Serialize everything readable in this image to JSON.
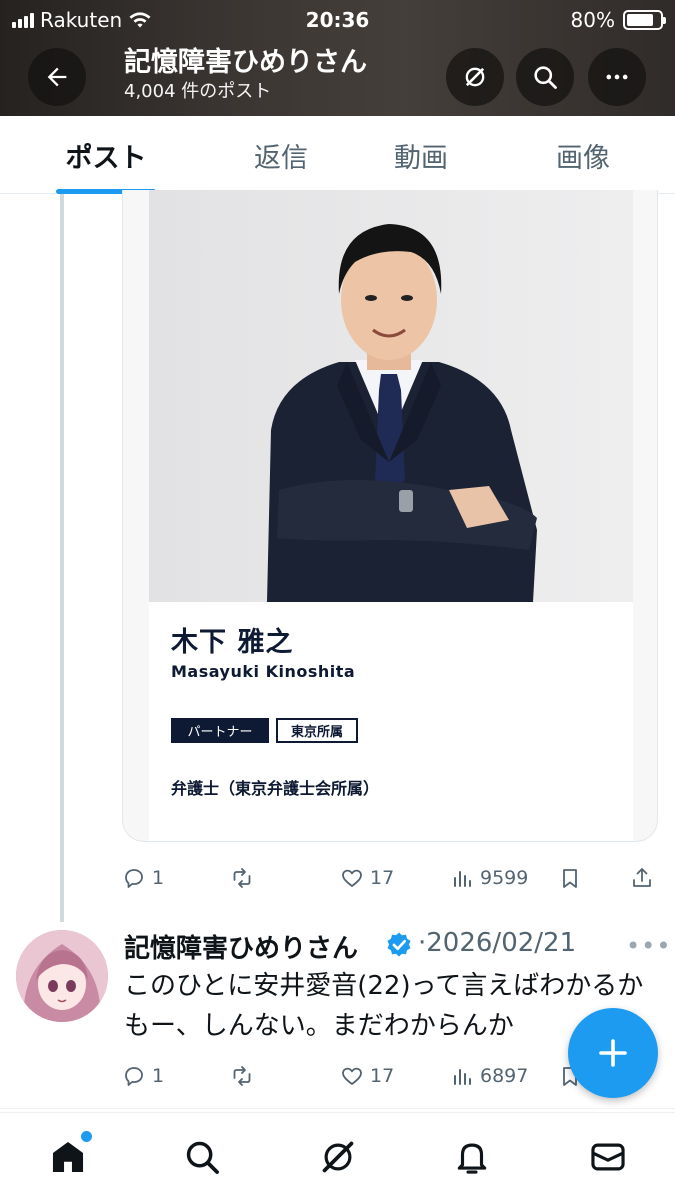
{
  "status_bar": {
    "carrier": "Rakuten",
    "time": "20:36",
    "battery": "80%"
  },
  "header": {
    "title": "記憶障害ひめりさん",
    "post_count": "4,004 件のポスト"
  },
  "tabs": [
    {
      "label": "ポスト",
      "active": true
    },
    {
      "label": "返信",
      "active": false
    },
    {
      "label": "動画",
      "active": false
    },
    {
      "label": "画像",
      "active": false
    }
  ],
  "card": {
    "name_ja": "木下 雅之",
    "name_en": "Masayuki Kinoshita",
    "tag_primary": "パートナー",
    "tag_secondary": "東京所属",
    "role": "弁護士（東京弁護士会所属）"
  },
  "post1_actions": {
    "replies": "1",
    "likes": "17",
    "views": "9599"
  },
  "tweet": {
    "author": "記憶障害ひめりさん",
    "date": "·2026/02/21",
    "text": "このひとに安井愛音(22)って言えばわかるかもー、しんない。まだわからんか"
  },
  "post2_actions": {
    "replies": "1",
    "likes": "17",
    "views": "6897"
  },
  "colors": {
    "accent": "#1d9bf0",
    "text_primary": "#0f1419",
    "text_secondary": "#536471",
    "card_navy": "#0e1a33"
  },
  "icons": {
    "back": "arrow-left-icon",
    "grok": "grok-icon",
    "search": "search-icon",
    "more": "more-horizontal-icon"
  }
}
